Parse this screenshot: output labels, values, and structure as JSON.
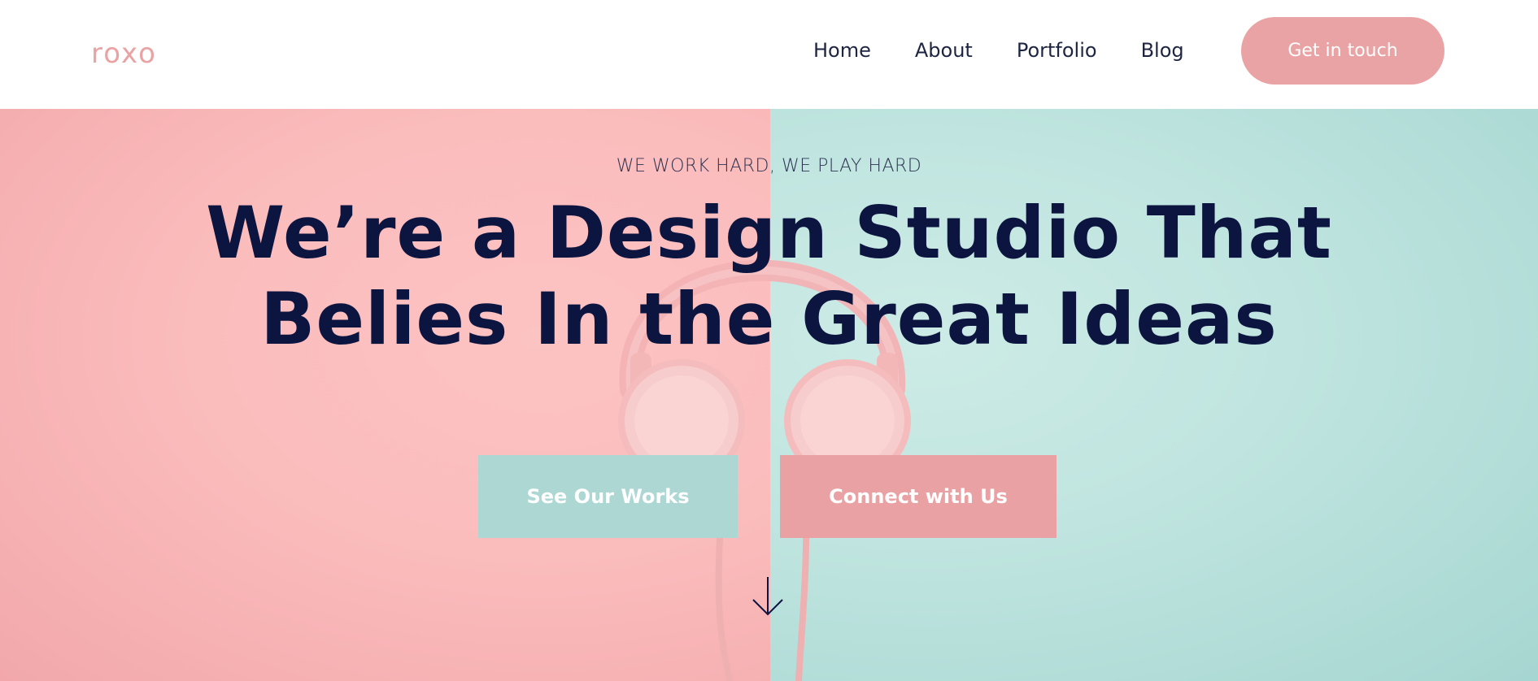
{
  "header": {
    "logo": "roxo",
    "nav": [
      {
        "label": "Home"
      },
      {
        "label": "About"
      },
      {
        "label": "Portfolio"
      },
      {
        "label": "Blog"
      }
    ],
    "cta_label": "Get in touch"
  },
  "hero": {
    "eyebrow": "WE WORK HARD, WE PLAY HARD",
    "headline_line1": "We’re a Design Studio That",
    "headline_line2": "Belies In the Great Ideas",
    "primary_button": "See Our Works",
    "secondary_button": "Connect with Us",
    "background_image": "pink-headphones-icon",
    "scroll_icon": "arrow-down-icon"
  },
  "colors": {
    "brand_pink": "#eaa3a4",
    "brand_teal": "#add7d3",
    "heading_navy": "#0c1440",
    "nav_text": "#1d2542",
    "hero_left_bg": "#fbbcbc",
    "hero_right_bg": "#bfe4df"
  }
}
